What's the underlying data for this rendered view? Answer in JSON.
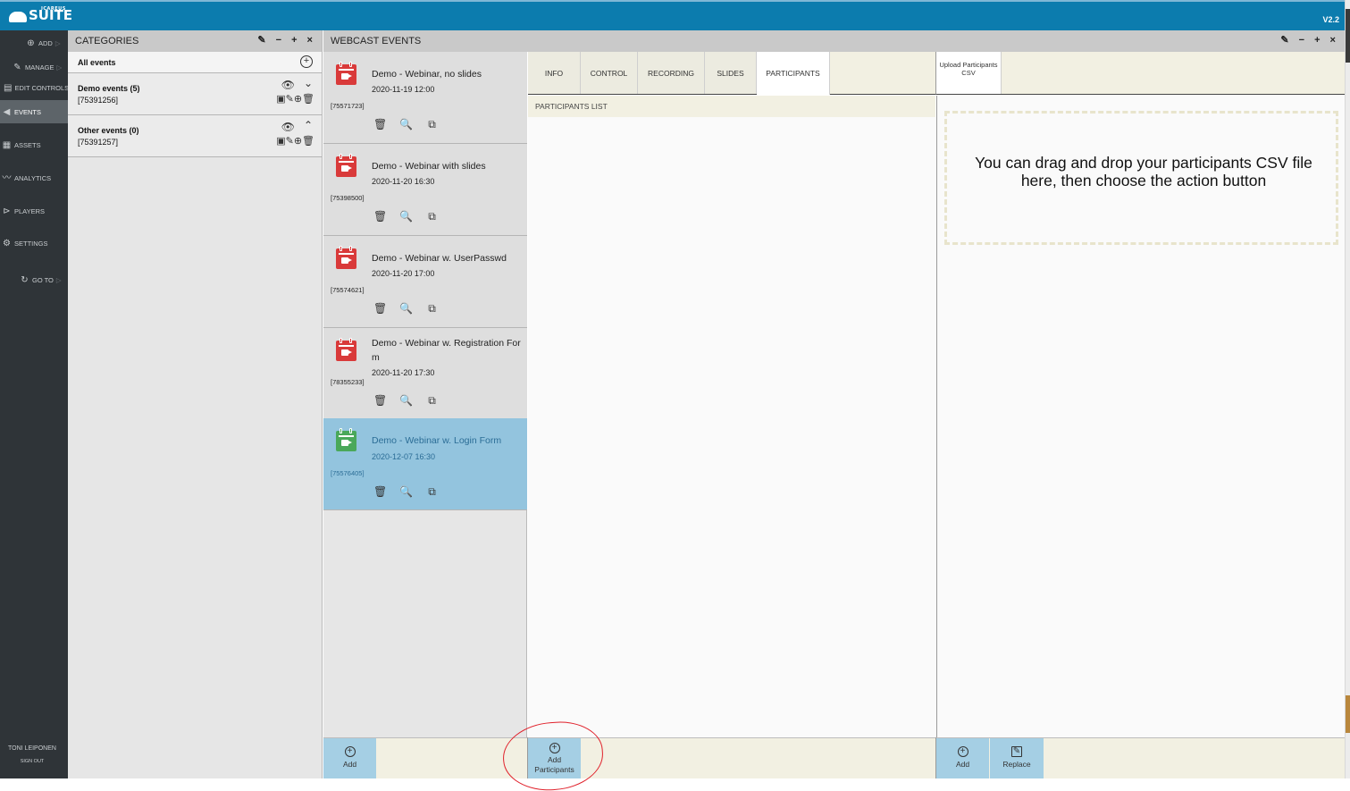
{
  "app": {
    "brand_small": "ICAREUS",
    "brand_main": "SUITE",
    "version": "V2.2"
  },
  "nav": {
    "items": [
      {
        "label": "ADD",
        "icon": "plus-circle-icon"
      },
      {
        "label": "MANAGE",
        "icon": "edit-icon"
      },
      {
        "label": "EDIT CONTROLS",
        "icon": "edit-controls-icon"
      },
      {
        "label": "EVENTS",
        "icon": "megaphone-icon"
      },
      {
        "label": "ASSETS",
        "icon": "grid-icon"
      },
      {
        "label": "ANALYTICS",
        "icon": "chart-line-icon"
      },
      {
        "label": "PLAYERS",
        "icon": "play-circle-icon"
      },
      {
        "label": "SETTINGS",
        "icon": "gear-icon"
      },
      {
        "label": "GO TO",
        "icon": "refresh-icon"
      }
    ],
    "user_name": "TONI LEIPONEN",
    "sign_out": "SIGN OUT"
  },
  "categories": {
    "title": "CATEGORIES",
    "controls": "✎ − + ×",
    "all_label": "All events",
    "items": [
      {
        "name": "Demo events (5)",
        "id": "[75391256]",
        "expanded_icon": "chevrons-down-icon"
      },
      {
        "name": "Other events (0)",
        "id": "[75391257]",
        "expanded_icon": "chevrons-up-icon"
      }
    ]
  },
  "webcast": {
    "title": "WEBCAST EVENTS",
    "controls": "✎ − + ×",
    "events": [
      {
        "title": "Demo - Webinar, no slides",
        "date": "2020-11-19 12:00",
        "id": "[75571723]"
      },
      {
        "title": "Demo - Webinar with slides",
        "date": "2020-11-20 16:30",
        "id": "[75398500]"
      },
      {
        "title": "Demo - Webinar w. UserPasswd",
        "date": "2020-11-20 17:00",
        "id": "[75574621]"
      },
      {
        "title": "Demo - Webinar w. Registration Form",
        "date": "2020-11-20 17:30",
        "id": "[78355233]"
      },
      {
        "title": "Demo - Webinar w. Login Form",
        "date": "2020-12-07 16:30",
        "id": "[75576405]"
      }
    ]
  },
  "tabs": [
    "INFO",
    "CONTROL",
    "RECORDING",
    "SLIDES",
    "PARTICIPANTS"
  ],
  "active_tab": "PARTICIPANTS",
  "participants": {
    "list_header": "PARTICIPANTS LIST",
    "upload_tab": "Upload Participants CSV",
    "drop_text": "You can drag and drop your participants CSV file here, then choose the action button"
  },
  "bottom": {
    "add_label": "Add",
    "add_participants_label": "Add Participants",
    "upload_add_label": "Add",
    "replace_label": "Replace"
  },
  "colors": {
    "topbar": "#0c7cae",
    "nav_bg": "#2f3438",
    "selected_event": "#93c4de",
    "calendar_red": "#d93a3a",
    "calendar_green": "#4aa85a",
    "annotation": "#e0202a"
  }
}
